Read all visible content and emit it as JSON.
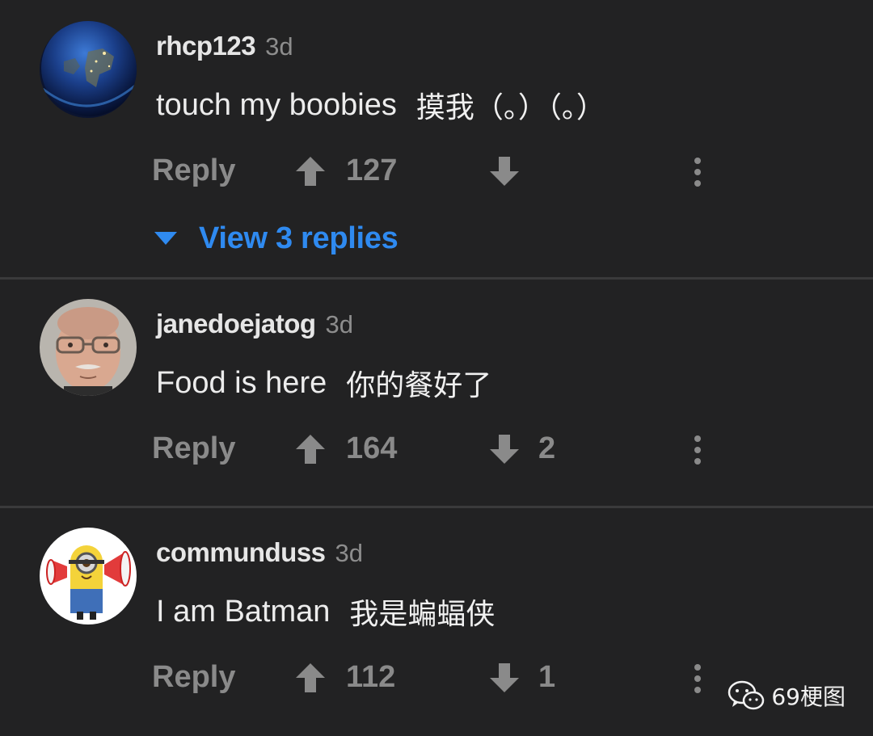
{
  "comments": [
    {
      "username": "rhcp123",
      "time": "3d",
      "text_en": "touch my boobies",
      "text_zh": "摸我（。）（。）",
      "reply_label": "Reply",
      "upvotes": "127",
      "downvotes": "",
      "avatar": "earth-avatar"
    },
    {
      "username": "janedoejatog",
      "time": "3d",
      "text_en": "Food is here",
      "text_zh": "你的餐好了",
      "reply_label": "Reply",
      "upvotes": "164",
      "downvotes": "2",
      "avatar": "man-glasses-avatar"
    },
    {
      "username": "communduss",
      "time": "3d",
      "text_en": "I am Batman",
      "text_zh": "我是蝙蝠侠",
      "reply_label": "Reply",
      "upvotes": "112",
      "downvotes": "1",
      "avatar": "minion-megaphone-avatar"
    }
  ],
  "view_replies_label": "View 3 replies",
  "watermark": "69梗图",
  "colors": {
    "background": "#222223",
    "link": "#2f8af0",
    "muted": "#8a8a8a",
    "username": "#e6e6e6"
  }
}
